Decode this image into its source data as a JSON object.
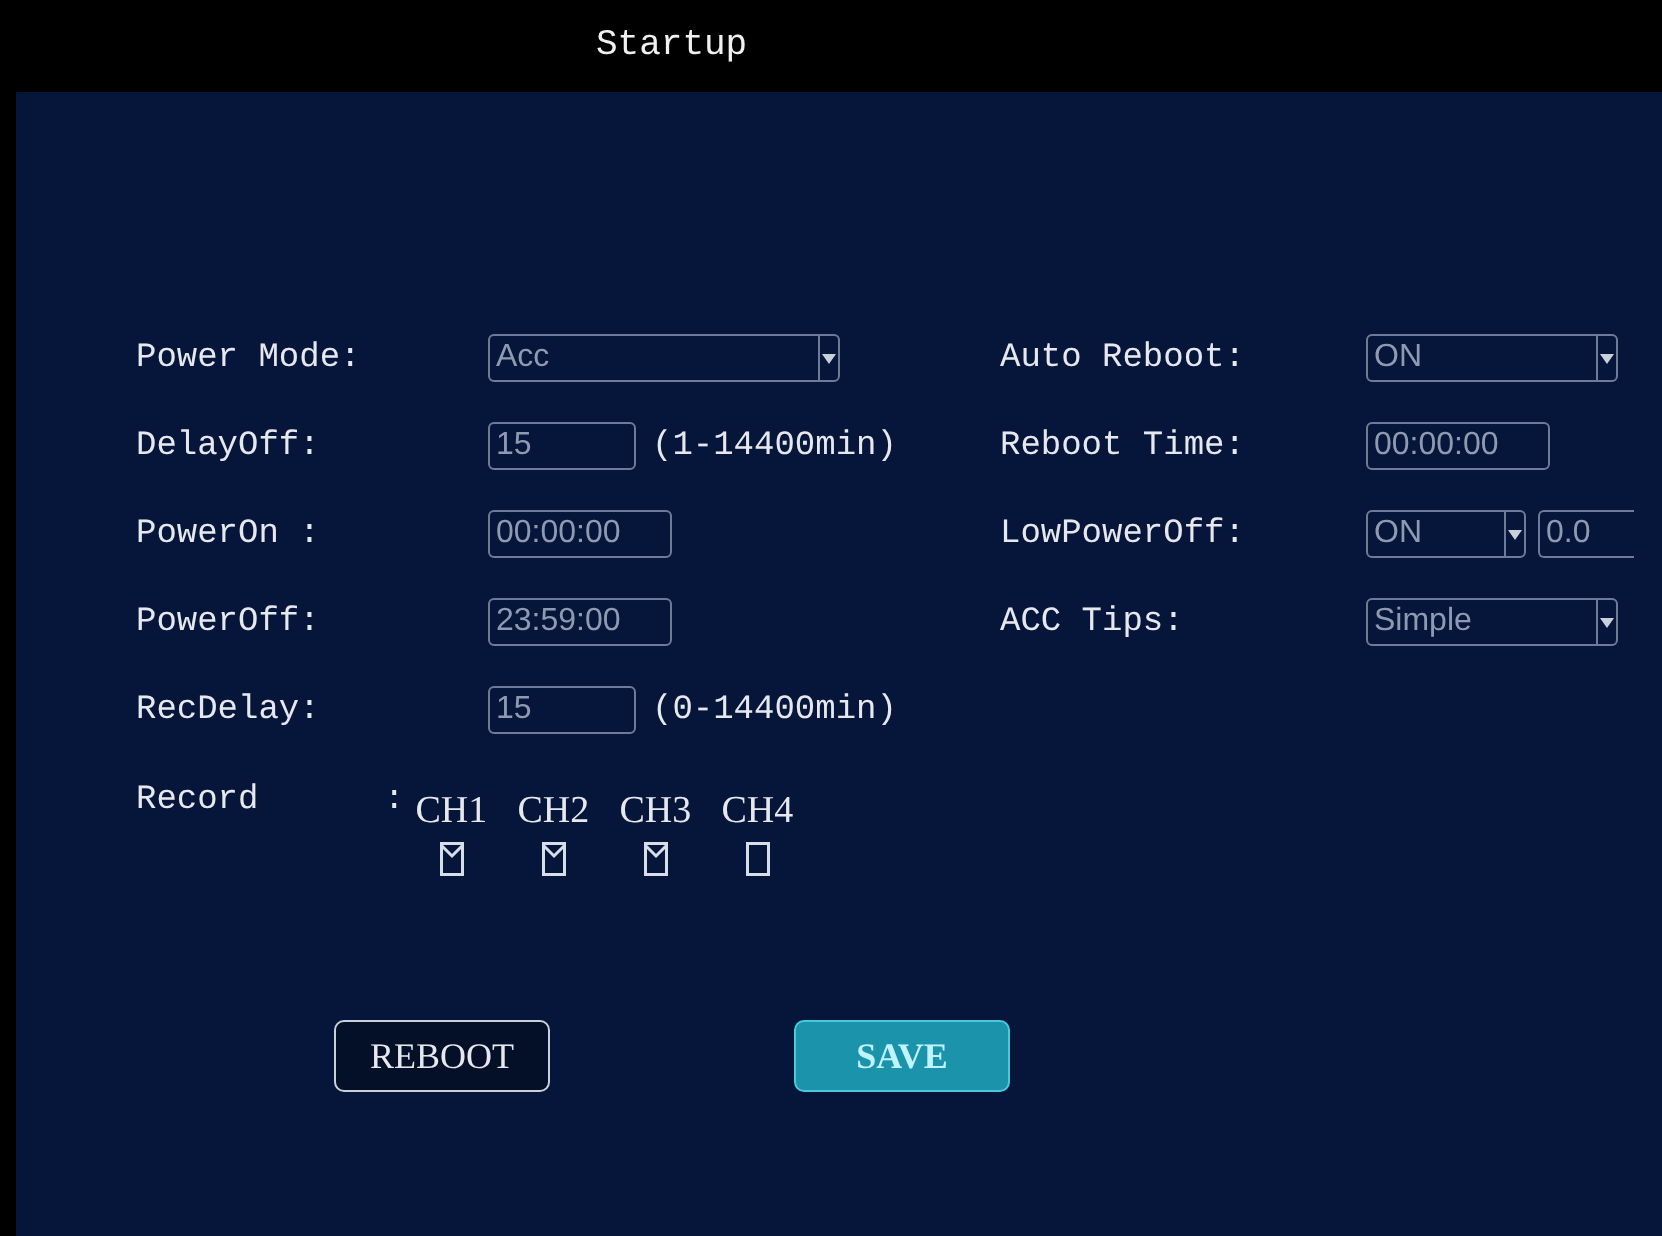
{
  "window": {
    "title": "Startup"
  },
  "left_fields": [
    {
      "label": "Power Mode:",
      "kind": "select",
      "value": "Acc"
    },
    {
      "label": "DelayOff:",
      "kind": "input",
      "value": "15",
      "hint": "(1-14400min)"
    },
    {
      "label": "PowerOn :",
      "kind": "time",
      "value": "00:00:00"
    },
    {
      "label": "PowerOff:",
      "kind": "time",
      "value": "23:59:00"
    },
    {
      "label": "RecDelay:",
      "kind": "input",
      "value": "15",
      "hint": "(0-14400min)"
    }
  ],
  "right_fields": [
    {
      "label": "Auto Reboot:",
      "kind": "select",
      "value": "ON"
    },
    {
      "label": "Reboot Time:",
      "kind": "time",
      "value": "00:00:00"
    },
    {
      "label": "LowPowerOff:",
      "kind": "select_input",
      "value": "ON",
      "extra": "0.0"
    },
    {
      "label": "ACC Tips:",
      "kind": "select",
      "value": "Simple"
    }
  ],
  "record": {
    "label": "Record",
    "separator": ":",
    "channels": [
      {
        "label": "CH1",
        "checked": true
      },
      {
        "label": "CH2",
        "checked": true
      },
      {
        "label": "CH3",
        "checked": true
      },
      {
        "label": "CH4",
        "checked": false
      }
    ]
  },
  "buttons": [
    {
      "label": "REBOOT",
      "selected": false
    },
    {
      "label": "SAVE",
      "selected": true
    }
  ]
}
